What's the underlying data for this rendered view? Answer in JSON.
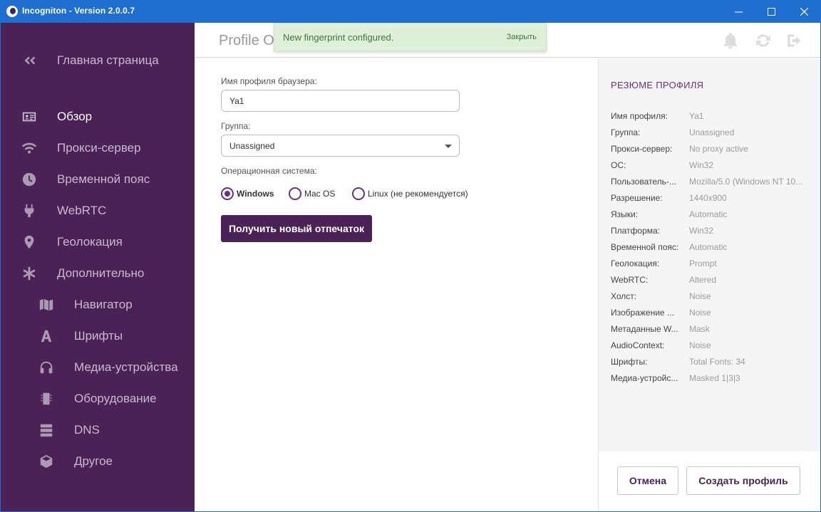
{
  "window": {
    "title": "Incogniton - Version 2.0.0.7",
    "accent": "#1f6fd1"
  },
  "sidebar": {
    "bg": "#4a2255",
    "back": {
      "label": "Главная страница",
      "icon": "double-chevron-left-icon"
    },
    "items": [
      {
        "label": "Обзор",
        "icon": "id-card-icon",
        "active": true
      },
      {
        "label": "Прокси-сервер",
        "icon": "wifi-icon"
      },
      {
        "label": "Временной пояс",
        "icon": "clock-icon"
      },
      {
        "label": "WebRTC",
        "icon": "plug-icon"
      },
      {
        "label": "Геолокация",
        "icon": "map-pin-icon"
      },
      {
        "label": "Дополнительно",
        "icon": "asterisk-icon"
      }
    ],
    "subitems": [
      {
        "label": "Навигатор",
        "icon": "map-icon"
      },
      {
        "label": "Шрифты",
        "icon": "font-icon"
      },
      {
        "label": "Медиа-устройства",
        "icon": "headphones-icon"
      },
      {
        "label": "Оборудование",
        "icon": "chip-icon"
      },
      {
        "label": "DNS",
        "icon": "server-icon"
      },
      {
        "label": "Другое",
        "icon": "cube-icon"
      }
    ]
  },
  "header": {
    "title": "Profile Ov",
    "icons": [
      "bell-icon",
      "refresh-icon",
      "sign-out-icon"
    ]
  },
  "toast": {
    "message": "New fingerprint configured.",
    "close_label": "Закрыть",
    "bg": "#dff0d8"
  },
  "form": {
    "profile_name_label": "Имя профиля браузера:",
    "profile_name_value": "Ya1",
    "group_label": "Группа:",
    "group_value": "Unassigned",
    "os_label": "Операционная система:",
    "os_options": [
      {
        "label": "Windows",
        "checked": true
      },
      {
        "label": "Mac OS",
        "checked": false
      },
      {
        "label": "Linux (не рекомендуется)",
        "checked": false
      }
    ],
    "fingerprint_button": "Получить новый отпечаток"
  },
  "summary": {
    "title": "РЕЗЮМЕ ПРОФИЛЯ",
    "rows": [
      {
        "key": "Имя профиля:",
        "value": "Ya1"
      },
      {
        "key": "Группа:",
        "value": "Unassigned"
      },
      {
        "key": "Прокси-сервер:",
        "value": "No proxy active"
      },
      {
        "key": "ОС:",
        "value": "Win32"
      },
      {
        "key": "Пользователь-...",
        "value": "Mozilla/5.0 (Windows NT 10..."
      },
      {
        "key": "Разрешение:",
        "value": "1440x900"
      },
      {
        "key": "Языки:",
        "value": "Automatic"
      },
      {
        "key": "Платформа:",
        "value": "Win32"
      },
      {
        "key": "Временной пояс:",
        "value": "Automatic"
      },
      {
        "key": "Геолокация:",
        "value": "Prompt"
      },
      {
        "key": "WebRTC:",
        "value": "Altered"
      },
      {
        "key": "Холст:",
        "value": "Noise"
      },
      {
        "key": "Изображение ...",
        "value": "Noise"
      },
      {
        "key": "Метаданные W...",
        "value": "Mask"
      },
      {
        "key": "AudioContext:",
        "value": "Noise"
      },
      {
        "key": "Шрифты:",
        "value": "Total Fonts: 34"
      },
      {
        "key": "Медиа-устройс...",
        "value": "Masked 1|3|3"
      }
    ]
  },
  "footer": {
    "cancel_label": "Отмена",
    "create_label": "Создать профиль"
  }
}
